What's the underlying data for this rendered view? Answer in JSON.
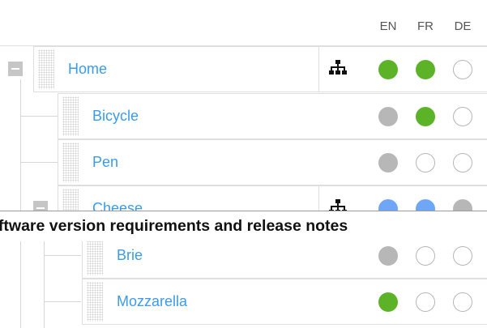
{
  "languages": [
    "EN",
    "FR",
    "DE"
  ],
  "rows": [
    {
      "label": "Home",
      "structure_icon": "sitemap-icon",
      "status": [
        "green",
        "green",
        "empty"
      ]
    },
    {
      "label": "Bicycle",
      "status": [
        "grey",
        "green",
        "empty"
      ]
    },
    {
      "label": "Pen",
      "status": [
        "grey",
        "empty",
        "empty"
      ]
    },
    {
      "label": "Cheese",
      "structure_icon": "sitemap-icon",
      "status": [
        "blue",
        "blue",
        "grey"
      ]
    },
    {
      "label": "Brie",
      "status": [
        "grey",
        "empty",
        "empty"
      ]
    },
    {
      "label": "Mozzarella",
      "status": [
        "green",
        "empty",
        "empty"
      ]
    }
  ],
  "banner": {
    "text": "oftware version requirements and release notes"
  },
  "colors": {
    "link": "#3c9be8",
    "green": "#5cb328",
    "grey": "#b7b7b7",
    "blue": "#6fa6f5"
  }
}
